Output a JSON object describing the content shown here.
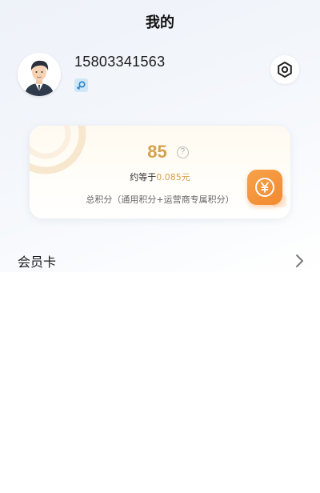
{
  "header": {
    "title": "我的"
  },
  "profile": {
    "phone": "15803341563",
    "avatar_icon": "male-avatar",
    "gender_icon": "male-gender-icon"
  },
  "settings": {
    "icon": "settings-icon"
  },
  "points_card": {
    "points": "85",
    "help_glyph": "?",
    "approx_prefix": "约等于",
    "approx_value": "0.085元",
    "total_label": "总积分（通用积分+运营商专属积分）",
    "coin_icon": "yuan-coin-icon",
    "accent_color": "#d4a24c",
    "coin_color": "#f28a30"
  },
  "menu": {
    "items": [
      {
        "label": "会员卡",
        "icon": "chevron-right-icon"
      }
    ]
  }
}
